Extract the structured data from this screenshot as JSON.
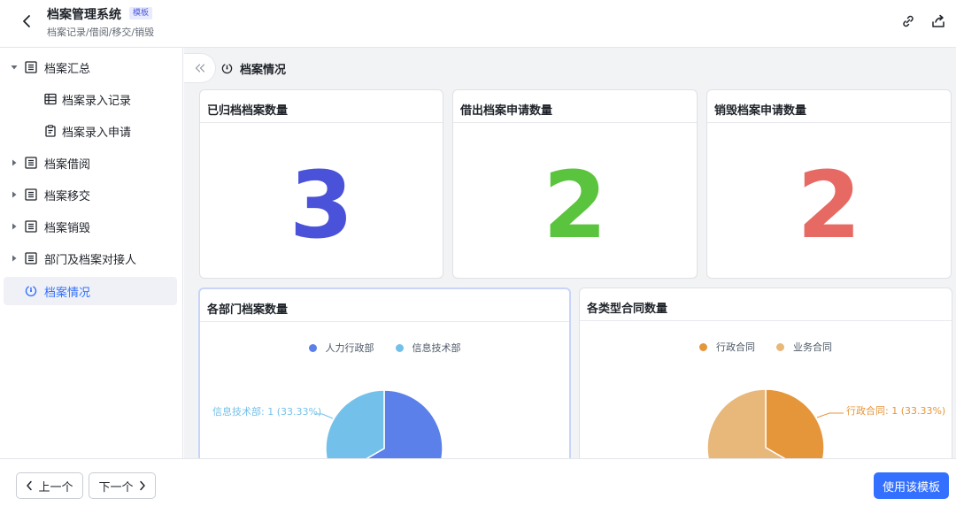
{
  "header": {
    "title": "档案管理系统",
    "badge": "模板",
    "breadcrumb": "档案记录/借阅/移交/销毁"
  },
  "icons": {
    "back": "chevron-left-icon",
    "link": "link-icon",
    "share": "share-icon"
  },
  "sidebar": {
    "items": [
      {
        "label": "档案汇总",
        "icon": "table-icon",
        "caret": "expanded"
      },
      {
        "label": "档案录入记录",
        "icon": "grid-icon",
        "caret": "none"
      },
      {
        "label": "档案录入申请",
        "icon": "form-icon",
        "caret": "none"
      },
      {
        "label": "档案借阅",
        "icon": "table-icon",
        "caret": "collapsed"
      },
      {
        "label": "档案移交",
        "icon": "table-icon",
        "caret": "collapsed"
      },
      {
        "label": "档案销毁",
        "icon": "table-icon",
        "caret": "collapsed"
      },
      {
        "label": "部门及档案对接人",
        "icon": "table-icon",
        "caret": "collapsed"
      },
      {
        "label": "档案情况",
        "icon": "dashboard-icon",
        "caret": "none",
        "active": true
      }
    ]
  },
  "main": {
    "page_title": "档案情况",
    "stats": [
      {
        "title": "已归档档案数量",
        "value": "3",
        "color": "#4a52d9"
      },
      {
        "title": "借出档案申请数量",
        "value": "2",
        "color": "#5bc43e"
      },
      {
        "title": "销毁档案申请数量",
        "value": "2",
        "color": "#e66a63"
      }
    ]
  },
  "chart_data": [
    {
      "type": "pie",
      "title": "各部门档案数量",
      "series": [
        {
          "name": "人力行政部",
          "value": 2,
          "color": "#5b80ea"
        },
        {
          "name": "信息技术部",
          "value": 1,
          "color": "#73c1ea"
        }
      ],
      "labels": [
        "信息技术部: 1 (33.33%)"
      ],
      "legend": "top-center"
    },
    {
      "type": "pie",
      "title": "各类型合同数量",
      "series": [
        {
          "name": "行政合同",
          "value": 1,
          "color": "#e5963b"
        },
        {
          "name": "业务合同",
          "value": 2,
          "color": "#e8b77a"
        }
      ],
      "labels": [
        "行政合同: 1 (33.33%)"
      ],
      "legend": "top-center"
    }
  ],
  "footer": {
    "prev": "上一个",
    "next": "下一个",
    "use_template": "使用该模板"
  }
}
